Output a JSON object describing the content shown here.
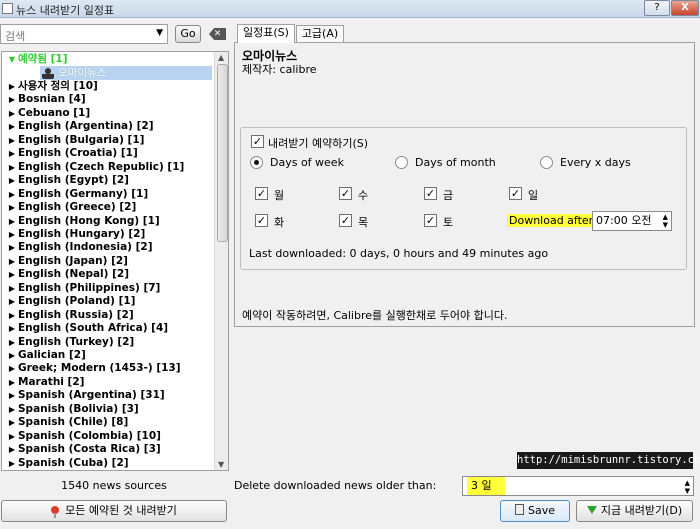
{
  "window": {
    "title": "뉴스 내려받기 일정표",
    "help_label": "?",
    "close_label": "X"
  },
  "left": {
    "search_placeholder": "검색",
    "go_label": "Go",
    "clear_label": "✕",
    "tree": {
      "scheduled_group": "예약됨 [1]",
      "scheduled_child": "오마이뉴스",
      "items": [
        "사용자 정의 [10]",
        "Bosnian [4]",
        "Cebuano [1]",
        "English (Argentina) [2]",
        "English (Bulgaria) [1]",
        "English (Croatia) [1]",
        "English (Czech Republic) [1]",
        "English (Egypt) [2]",
        "English (Germany) [1]",
        "English (Greece) [2]",
        "English (Hong Kong) [1]",
        "English (Hungary) [2]",
        "English (Indonesia) [2]",
        "English (Japan) [2]",
        "English (Nepal) [2]",
        "English (Philippines) [7]",
        "English (Poland) [1]",
        "English (Russia) [2]",
        "English (South Africa) [4]",
        "English (Turkey) [2]",
        "Galician [2]",
        "Greek; Modern (1453-) [13]",
        "Marathi [2]",
        "Spanish (Argentina) [31]",
        "Spanish (Bolivia) [3]",
        "Spanish (Chile) [8]",
        "Spanish (Colombia) [10]",
        "Spanish (Costa Rica) [3]",
        "Spanish (Cuba) [2]"
      ]
    },
    "sources_count": "1540 news sources",
    "download_all_label": "모든 예약된 것 내려받기"
  },
  "right": {
    "tabs": [
      "일정표(S)",
      "고급(A)"
    ],
    "recipe_title": "오마이뉴스",
    "recipe_author": "제작자: calibre",
    "schedule_checkbox_label": "내려받기 예약하기(S)",
    "radio": {
      "days_of_week": "Days of  week",
      "days_of_month": "Days of month",
      "every_x_days": "Every x days"
    },
    "days": [
      "월",
      "수",
      "금",
      "일",
      "화",
      "목",
      "토"
    ],
    "download_after_label": "Download after:",
    "download_after_value": "07:00 오전",
    "last_downloaded": "Last downloaded: 0 days, 0 hours and 49 minutes ago",
    "note": "예약이 작동하려면, Calibre를 실행한채로 두어야 합니다.",
    "watermark": "http://mimisbrunnr.tistory.com",
    "delete_label": "Delete downloaded news older than:",
    "delete_value": "3 일",
    "save_label": "Save",
    "download_now_label": "지금 내려받기(D)"
  },
  "colors": {
    "highlight": "#ffff3a",
    "group_green": "#2ecc2e",
    "selection": "#b9d3f0"
  }
}
